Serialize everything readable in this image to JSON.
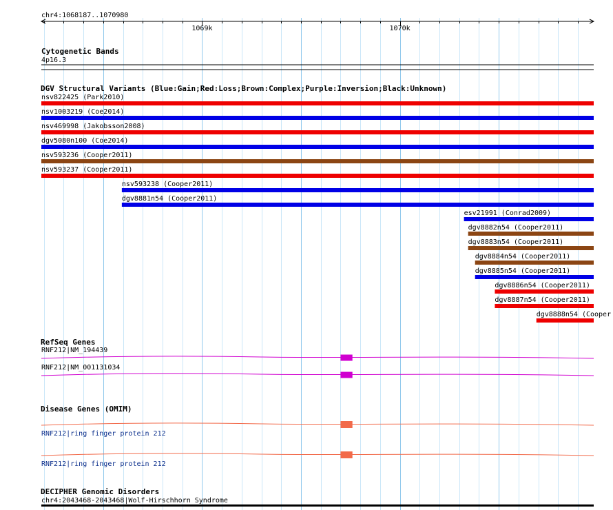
{
  "ruler": {
    "region": "chr4:1068187..1070980",
    "ticks": [
      {
        "label": "1069k",
        "pos": 1069000
      },
      {
        "label": "1070k",
        "pos": 1070000
      }
    ]
  },
  "cytobands": {
    "title": "Cytogenetic Bands",
    "band": "4p16.3"
  },
  "dgv": {
    "title": "DGV Structural Variants (Blue:Gain;Red:Loss;Brown:Complex;Purple:Inversion;Black:Unknown)",
    "colors": {
      "gain": "#0000e6",
      "loss": "#ee0000",
      "complex": "#8b4513"
    },
    "variants": [
      {
        "label": "nsv822425 (Park2010)",
        "type": "loss",
        "start": 1068187,
        "end": 1070980
      },
      {
        "label": "nsv1003219 (Coe2014)",
        "type": "gain",
        "start": 1068187,
        "end": 1070980
      },
      {
        "label": "nsv469998 (Jakobsson2008)",
        "type": "loss",
        "start": 1068187,
        "end": 1070980
      },
      {
        "label": "dgv5080n100 (Coe2014)",
        "type": "gain",
        "start": 1068187,
        "end": 1070980
      },
      {
        "label": "nsv593236 (Cooper2011)",
        "type": "complex",
        "start": 1068187,
        "end": 1070980
      },
      {
        "label": "nsv593237 (Cooper2011)",
        "type": "loss",
        "start": 1068187,
        "end": 1070980
      },
      {
        "label": "nsv593238 (Cooper2011)",
        "type": "gain",
        "start": 1068594,
        "end": 1070980
      },
      {
        "label": "dgv8881n54 (Cooper2011)",
        "type": "gain",
        "start": 1068594,
        "end": 1070980
      },
      {
        "label": "esv21991 (Conrad2009)",
        "type": "gain",
        "start": 1070324,
        "end": 1070980
      },
      {
        "label": "dgv8882n54 (Cooper2011)",
        "type": "complex",
        "start": 1070345,
        "end": 1070980
      },
      {
        "label": "dgv8883n54 (Cooper2011)",
        "type": "complex",
        "start": 1070345,
        "end": 1070980
      },
      {
        "label": "dgv8884n54 (Cooper2011)",
        "type": "complex",
        "start": 1070380,
        "end": 1070980
      },
      {
        "label": "dgv8885n54 (Cooper2011)",
        "type": "gain",
        "start": 1070380,
        "end": 1070980
      },
      {
        "label": "dgv8886n54 (Cooper2011)",
        "type": "loss",
        "start": 1070480,
        "end": 1070980
      },
      {
        "label": "dgv8887n54 (Cooper2011)",
        "type": "loss",
        "start": 1070480,
        "end": 1070980
      },
      {
        "label": "dgv8888n54 (Cooper",
        "type": "loss",
        "start": 1070690,
        "end": 1070980
      }
    ]
  },
  "refseq": {
    "title": "RefSeq Genes",
    "color": "#d000d0",
    "genes": [
      {
        "label": "RNF212|NM_194439",
        "exon_start": 1069700,
        "exon_end": 1069760
      },
      {
        "label": "RNF212|NM_001131034",
        "exon_start": 1069700,
        "exon_end": 1069760
      }
    ]
  },
  "omim": {
    "title": "Disease Genes (OMIM)",
    "color": "#f26a4a",
    "genes": [
      {
        "label": "RNF212|ring finger protein 212",
        "exon_start": 1069700,
        "exon_end": 1069760
      },
      {
        "label": "RNF212|ring finger protein 212",
        "exon_start": 1069700,
        "exon_end": 1069760
      }
    ]
  },
  "decipher": {
    "title": "DECIPHER Genomic Disorders",
    "item": "chr4:2043468-2043468|Wolf-Hirschhorn Syndrome"
  }
}
